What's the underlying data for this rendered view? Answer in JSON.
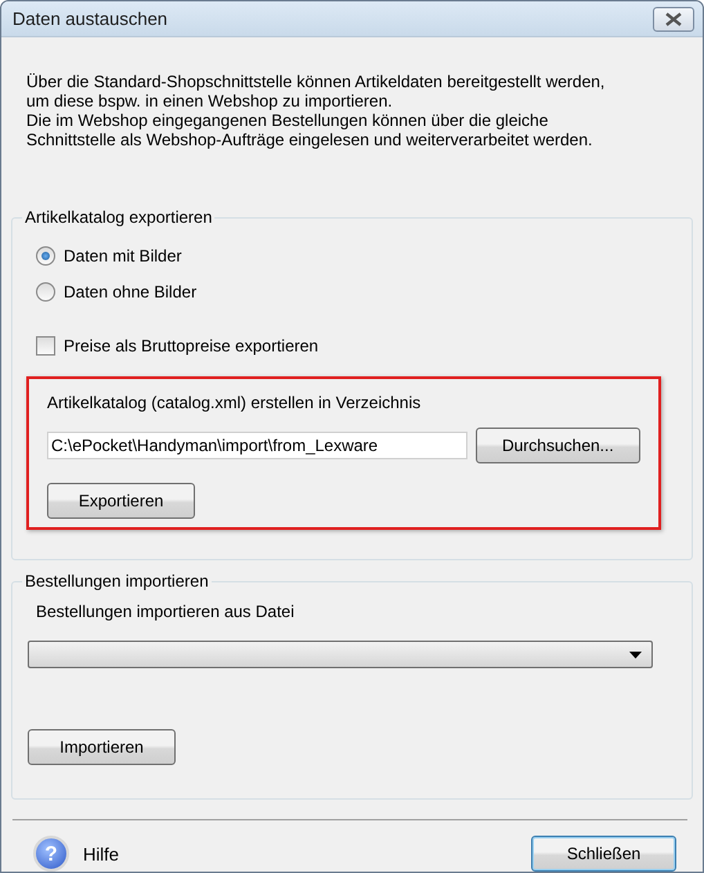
{
  "window": {
    "title": "Daten austauschen"
  },
  "intro": [
    "Über die Standard-Shopschnittstelle können Artikeldaten bereitgestellt werden, um diese bspw. in einen Webshop zu importieren.",
    "Die im Webshop eingegangenen Bestellungen können über die gleiche Schnittstelle  als Webshop-Aufträge eingelesen und weiterverarbeitet werden."
  ],
  "export_group": {
    "title": "Artikelkatalog exportieren",
    "options": [
      {
        "label": "Daten mit Bilder",
        "selected": true
      },
      {
        "label": "Daten ohne Bilder",
        "selected": false
      }
    ],
    "gross_prices": {
      "label": "Preise als Bruttopreise exportieren",
      "checked": false
    },
    "directory_label": "Artikelkatalog (catalog.xml) erstellen in Verzeichnis",
    "directory": "C:\\ePocket\\Handyman\\import\\from_Lexware",
    "browse_button": "Durchsuchen...",
    "export_button": "Exportieren",
    "highlighted": true
  },
  "import_group": {
    "title": "Bestellungen importieren",
    "file_label": "Bestellungen importieren aus Datei",
    "import_button": "Importieren"
  },
  "footer": {
    "help_icon": "?",
    "help": "Hilfe",
    "close_button": "Schließen"
  }
}
